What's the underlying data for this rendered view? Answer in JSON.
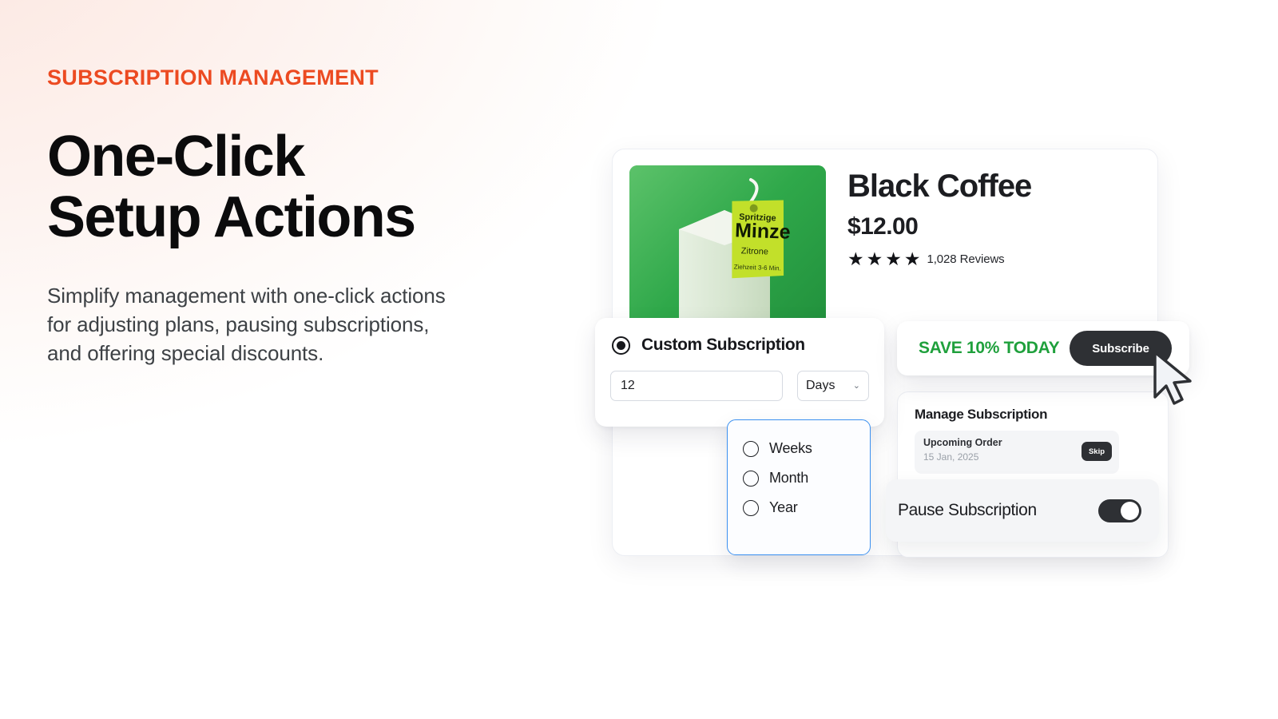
{
  "theme": {
    "accent_orange": "#ec4a21",
    "green": "#1fa03c",
    "dark": "#2e3034",
    "dropdown_border_blue": "#3b90f0"
  },
  "hero": {
    "eyebrow": "SUBSCRIPTION MANAGEMENT",
    "headline": "One-Click\nSetup Actions",
    "subcopy": "Simplify management with one-click actions\nfor adjusting plans, pausing subscriptions,\nand offering special discounts."
  },
  "product": {
    "title": "Black Coffee",
    "price": "$12.00",
    "stars_filled": 4,
    "star_glyph": "★",
    "reviews": "1,028 Reviews",
    "image": {
      "alt": "tea-bag-photo",
      "background_color": "#2fa84a",
      "tag_line1": "Spritzige",
      "tag_line2": "Minze",
      "tag_line3": "Zitrone",
      "tag_line4": "Ziehzeit 3-6 Min."
    }
  },
  "custom_subscription": {
    "title": "Custom Subscription",
    "selected": true,
    "interval_value": "12",
    "interval_placeholder": "12",
    "unit_selected": "Days",
    "chevron": "⌄",
    "options": [
      {
        "label": "Weeks",
        "selected": false
      },
      {
        "label": "Month",
        "selected": false
      },
      {
        "label": "Year",
        "selected": false
      }
    ]
  },
  "promo": {
    "save_text": "SAVE 10% TODAY",
    "subscribe_label": "Subscribe"
  },
  "manage": {
    "title": "Manage Subscription",
    "upcoming_label": "Upcoming Order",
    "upcoming_date": "15 Jan, 2025",
    "skip_label": "Skip"
  },
  "pause": {
    "label": "Pause Subscription",
    "toggle_on": true
  },
  "decor": {
    "cursor_tile_icon": "cursor-arrow-icon",
    "click_spark_icon": "click-spark-icon",
    "pointer_icon": "mouse-pointer-icon"
  }
}
